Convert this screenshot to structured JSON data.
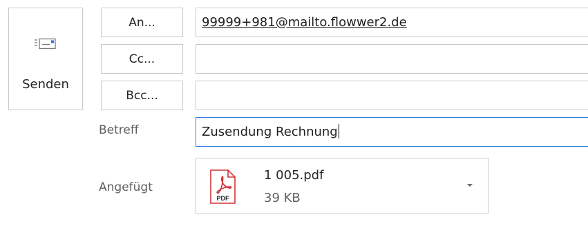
{
  "send": {
    "label": "Senden",
    "icon": "send-envelope-icon"
  },
  "recipients": {
    "to_button": "An...",
    "cc_button": "Cc...",
    "bcc_button": "Bcc...",
    "to_value": "99999+981@mailto.flowwer2.de",
    "cc_value": "",
    "bcc_value": ""
  },
  "subject": {
    "label": "Betreff",
    "value": "Zusendung Rechnung"
  },
  "attachments": {
    "label": "Angefügt",
    "items": [
      {
        "name": "1 005.pdf",
        "size": "39 KB",
        "icon": "pdf-file-icon",
        "badge": "PDF"
      }
    ]
  },
  "colors": {
    "border": "#c8c8c8",
    "focus_border": "#2b79d8",
    "pdf_red": "#d13438",
    "send_icon_blue": "#2b79d8"
  }
}
